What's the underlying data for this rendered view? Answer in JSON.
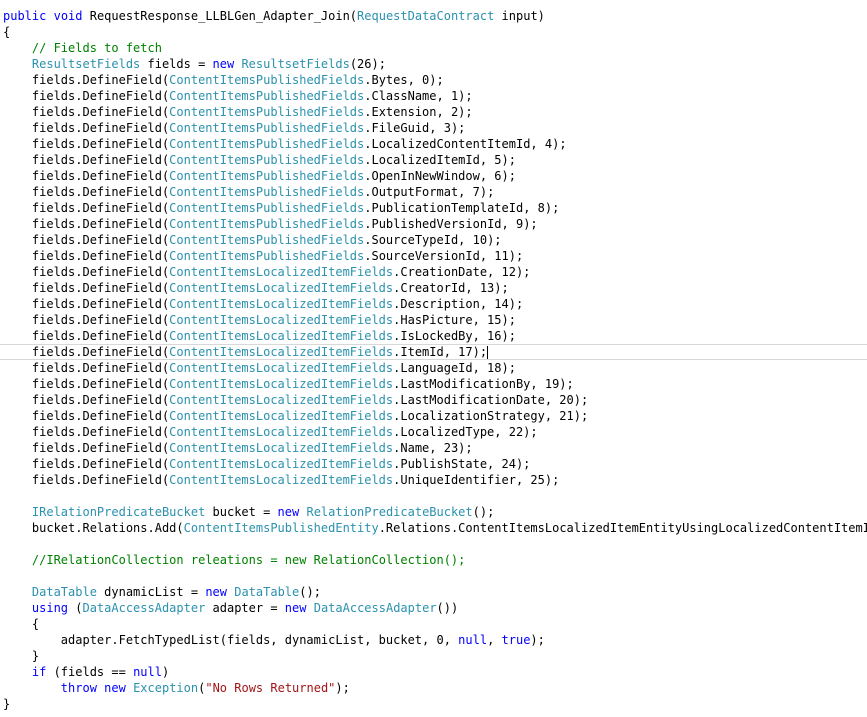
{
  "editor": {
    "current_line": 21,
    "lines": [
      [
        {
          "t": "kw",
          "v": "public"
        },
        {
          "t": "pl",
          "v": " "
        },
        {
          "t": "kw",
          "v": "void"
        },
        {
          "t": "pl",
          "v": " RequestResponse_LLBLGen_Adapter_Join("
        },
        {
          "t": "ty",
          "v": "RequestDataContract"
        },
        {
          "t": "pl",
          "v": " input)"
        }
      ],
      [
        {
          "t": "pl",
          "v": "{"
        }
      ],
      [
        {
          "t": "pl",
          "v": "    "
        },
        {
          "t": "cm",
          "v": "// Fields to fetch"
        }
      ],
      [
        {
          "t": "pl",
          "v": "    "
        },
        {
          "t": "ty",
          "v": "ResultsetFields"
        },
        {
          "t": "pl",
          "v": " fields = "
        },
        {
          "t": "kw",
          "v": "new"
        },
        {
          "t": "pl",
          "v": " "
        },
        {
          "t": "ty",
          "v": "ResultsetFields"
        },
        {
          "t": "pl",
          "v": "(26);"
        }
      ],
      [
        {
          "t": "pl",
          "v": "    fields.DefineField("
        },
        {
          "t": "ty",
          "v": "ContentItemsPublishedFields"
        },
        {
          "t": "pl",
          "v": ".Bytes, 0);"
        }
      ],
      [
        {
          "t": "pl",
          "v": "    fields.DefineField("
        },
        {
          "t": "ty",
          "v": "ContentItemsPublishedFields"
        },
        {
          "t": "pl",
          "v": ".ClassName, 1);"
        }
      ],
      [
        {
          "t": "pl",
          "v": "    fields.DefineField("
        },
        {
          "t": "ty",
          "v": "ContentItemsPublishedFields"
        },
        {
          "t": "pl",
          "v": ".Extension, 2);"
        }
      ],
      [
        {
          "t": "pl",
          "v": "    fields.DefineField("
        },
        {
          "t": "ty",
          "v": "ContentItemsPublishedFields"
        },
        {
          "t": "pl",
          "v": ".FileGuid, 3);"
        }
      ],
      [
        {
          "t": "pl",
          "v": "    fields.DefineField("
        },
        {
          "t": "ty",
          "v": "ContentItemsPublishedFields"
        },
        {
          "t": "pl",
          "v": ".LocalizedContentItemId, 4);"
        }
      ],
      [
        {
          "t": "pl",
          "v": "    fields.DefineField("
        },
        {
          "t": "ty",
          "v": "ContentItemsPublishedFields"
        },
        {
          "t": "pl",
          "v": ".LocalizedItemId, 5);"
        }
      ],
      [
        {
          "t": "pl",
          "v": "    fields.DefineField("
        },
        {
          "t": "ty",
          "v": "ContentItemsPublishedFields"
        },
        {
          "t": "pl",
          "v": ".OpenInNewWindow, 6);"
        }
      ],
      [
        {
          "t": "pl",
          "v": "    fields.DefineField("
        },
        {
          "t": "ty",
          "v": "ContentItemsPublishedFields"
        },
        {
          "t": "pl",
          "v": ".OutputFormat, 7);"
        }
      ],
      [
        {
          "t": "pl",
          "v": "    fields.DefineField("
        },
        {
          "t": "ty",
          "v": "ContentItemsPublishedFields"
        },
        {
          "t": "pl",
          "v": ".PublicationTemplateId, 8);"
        }
      ],
      [
        {
          "t": "pl",
          "v": "    fields.DefineField("
        },
        {
          "t": "ty",
          "v": "ContentItemsPublishedFields"
        },
        {
          "t": "pl",
          "v": ".PublishedVersionId, 9);"
        }
      ],
      [
        {
          "t": "pl",
          "v": "    fields.DefineField("
        },
        {
          "t": "ty",
          "v": "ContentItemsPublishedFields"
        },
        {
          "t": "pl",
          "v": ".SourceTypeId, 10);"
        }
      ],
      [
        {
          "t": "pl",
          "v": "    fields.DefineField("
        },
        {
          "t": "ty",
          "v": "ContentItemsPublishedFields"
        },
        {
          "t": "pl",
          "v": ".SourceVersionId, 11);"
        }
      ],
      [
        {
          "t": "pl",
          "v": "    fields.DefineField("
        },
        {
          "t": "ty",
          "v": "ContentItemsLocalizedItemFields"
        },
        {
          "t": "pl",
          "v": ".CreationDate, 12);"
        }
      ],
      [
        {
          "t": "pl",
          "v": "    fields.DefineField("
        },
        {
          "t": "ty",
          "v": "ContentItemsLocalizedItemFields"
        },
        {
          "t": "pl",
          "v": ".CreatorId, 13);"
        }
      ],
      [
        {
          "t": "pl",
          "v": "    fields.DefineField("
        },
        {
          "t": "ty",
          "v": "ContentItemsLocalizedItemFields"
        },
        {
          "t": "pl",
          "v": ".Description, 14);"
        }
      ],
      [
        {
          "t": "pl",
          "v": "    fields.DefineField("
        },
        {
          "t": "ty",
          "v": "ContentItemsLocalizedItemFields"
        },
        {
          "t": "pl",
          "v": ".HasPicture, 15);"
        }
      ],
      [
        {
          "t": "pl",
          "v": "    fields.DefineField("
        },
        {
          "t": "ty",
          "v": "ContentItemsLocalizedItemFields"
        },
        {
          "t": "pl",
          "v": ".IsLockedBy, 16);"
        }
      ],
      [
        {
          "t": "pl",
          "v": "    fields.DefineField("
        },
        {
          "t": "ty",
          "v": "ContentItemsLocalizedItemFields"
        },
        {
          "t": "pl",
          "v": ".ItemId, 17);"
        }
      ],
      [
        {
          "t": "pl",
          "v": "    fields.DefineField("
        },
        {
          "t": "ty",
          "v": "ContentItemsLocalizedItemFields"
        },
        {
          "t": "pl",
          "v": ".LanguageId, 18);"
        }
      ],
      [
        {
          "t": "pl",
          "v": "    fields.DefineField("
        },
        {
          "t": "ty",
          "v": "ContentItemsLocalizedItemFields"
        },
        {
          "t": "pl",
          "v": ".LastModificationBy, 19);"
        }
      ],
      [
        {
          "t": "pl",
          "v": "    fields.DefineField("
        },
        {
          "t": "ty",
          "v": "ContentItemsLocalizedItemFields"
        },
        {
          "t": "pl",
          "v": ".LastModificationDate, 20);"
        }
      ],
      [
        {
          "t": "pl",
          "v": "    fields.DefineField("
        },
        {
          "t": "ty",
          "v": "ContentItemsLocalizedItemFields"
        },
        {
          "t": "pl",
          "v": ".LocalizationStrategy, 21);"
        }
      ],
      [
        {
          "t": "pl",
          "v": "    fields.DefineField("
        },
        {
          "t": "ty",
          "v": "ContentItemsLocalizedItemFields"
        },
        {
          "t": "pl",
          "v": ".LocalizedType, 22);"
        }
      ],
      [
        {
          "t": "pl",
          "v": "    fields.DefineField("
        },
        {
          "t": "ty",
          "v": "ContentItemsLocalizedItemFields"
        },
        {
          "t": "pl",
          "v": ".Name, 23);"
        }
      ],
      [
        {
          "t": "pl",
          "v": "    fields.DefineField("
        },
        {
          "t": "ty",
          "v": "ContentItemsLocalizedItemFields"
        },
        {
          "t": "pl",
          "v": ".PublishState, 24);"
        }
      ],
      [
        {
          "t": "pl",
          "v": "    fields.DefineField("
        },
        {
          "t": "ty",
          "v": "ContentItemsLocalizedItemFields"
        },
        {
          "t": "pl",
          "v": ".UniqueIdentifier, 25);"
        }
      ],
      [],
      [
        {
          "t": "pl",
          "v": "    "
        },
        {
          "t": "ty",
          "v": "IRelationPredicateBucket"
        },
        {
          "t": "pl",
          "v": " bucket = "
        },
        {
          "t": "kw",
          "v": "new"
        },
        {
          "t": "pl",
          "v": " "
        },
        {
          "t": "ty",
          "v": "RelationPredicateBucket"
        },
        {
          "t": "pl",
          "v": "();"
        }
      ],
      [
        {
          "t": "pl",
          "v": "    bucket.Relations.Add("
        },
        {
          "t": "ty",
          "v": "ContentItemsPublishedEntity"
        },
        {
          "t": "pl",
          "v": ".Relations.ContentItemsLocalizedItemEntityUsingLocalizedContentItemId);"
        }
      ],
      [],
      [
        {
          "t": "pl",
          "v": "    "
        },
        {
          "t": "cm",
          "v": "//IRelationCollection releations = new RelationCollection();"
        }
      ],
      [],
      [
        {
          "t": "pl",
          "v": "    "
        },
        {
          "t": "ty",
          "v": "DataTable"
        },
        {
          "t": "pl",
          "v": " dynamicList = "
        },
        {
          "t": "kw",
          "v": "new"
        },
        {
          "t": "pl",
          "v": " "
        },
        {
          "t": "ty",
          "v": "DataTable"
        },
        {
          "t": "pl",
          "v": "();"
        }
      ],
      [
        {
          "t": "pl",
          "v": "    "
        },
        {
          "t": "kw",
          "v": "using"
        },
        {
          "t": "pl",
          "v": " ("
        },
        {
          "t": "ty",
          "v": "DataAccessAdapter"
        },
        {
          "t": "pl",
          "v": " adapter = "
        },
        {
          "t": "kw",
          "v": "new"
        },
        {
          "t": "pl",
          "v": " "
        },
        {
          "t": "ty",
          "v": "DataAccessAdapter"
        },
        {
          "t": "pl",
          "v": "())"
        }
      ],
      [
        {
          "t": "pl",
          "v": "    {"
        }
      ],
      [
        {
          "t": "pl",
          "v": "        adapter.FetchTypedList(fields, dynamicList, bucket, 0, "
        },
        {
          "t": "kw",
          "v": "null"
        },
        {
          "t": "pl",
          "v": ", "
        },
        {
          "t": "kw",
          "v": "true"
        },
        {
          "t": "pl",
          "v": ");"
        }
      ],
      [
        {
          "t": "pl",
          "v": "    }"
        }
      ],
      [
        {
          "t": "pl",
          "v": "    "
        },
        {
          "t": "kw",
          "v": "if"
        },
        {
          "t": "pl",
          "v": " (fields == "
        },
        {
          "t": "kw",
          "v": "null"
        },
        {
          "t": "pl",
          "v": ")"
        }
      ],
      [
        {
          "t": "pl",
          "v": "        "
        },
        {
          "t": "kw",
          "v": "throw"
        },
        {
          "t": "pl",
          "v": " "
        },
        {
          "t": "kw",
          "v": "new"
        },
        {
          "t": "pl",
          "v": " "
        },
        {
          "t": "ty",
          "v": "Exception"
        },
        {
          "t": "pl",
          "v": "("
        },
        {
          "t": "st",
          "v": "\"No Rows Returned\""
        },
        {
          "t": "pl",
          "v": ");"
        }
      ],
      [
        {
          "t": "pl",
          "v": "}"
        }
      ]
    ]
  }
}
